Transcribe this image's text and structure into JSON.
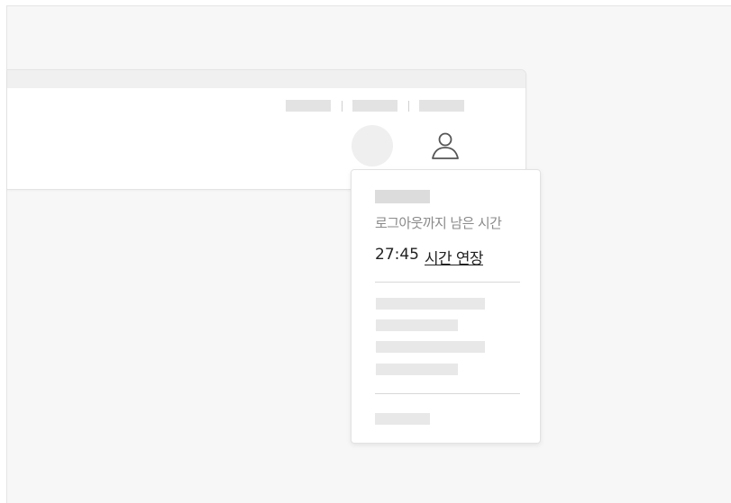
{
  "session": {
    "remaining_label": "로그아웃까지 남은 시간",
    "remaining_time": "27:45",
    "extend_label": "시간 연장"
  },
  "header": {
    "user_icon": "user-icon"
  },
  "colors": {
    "background": "#f7f7f7",
    "panel": "#ffffff",
    "skeleton": "#e8e8e8",
    "text_primary": "#222222",
    "text_secondary": "#8a8a8a"
  }
}
